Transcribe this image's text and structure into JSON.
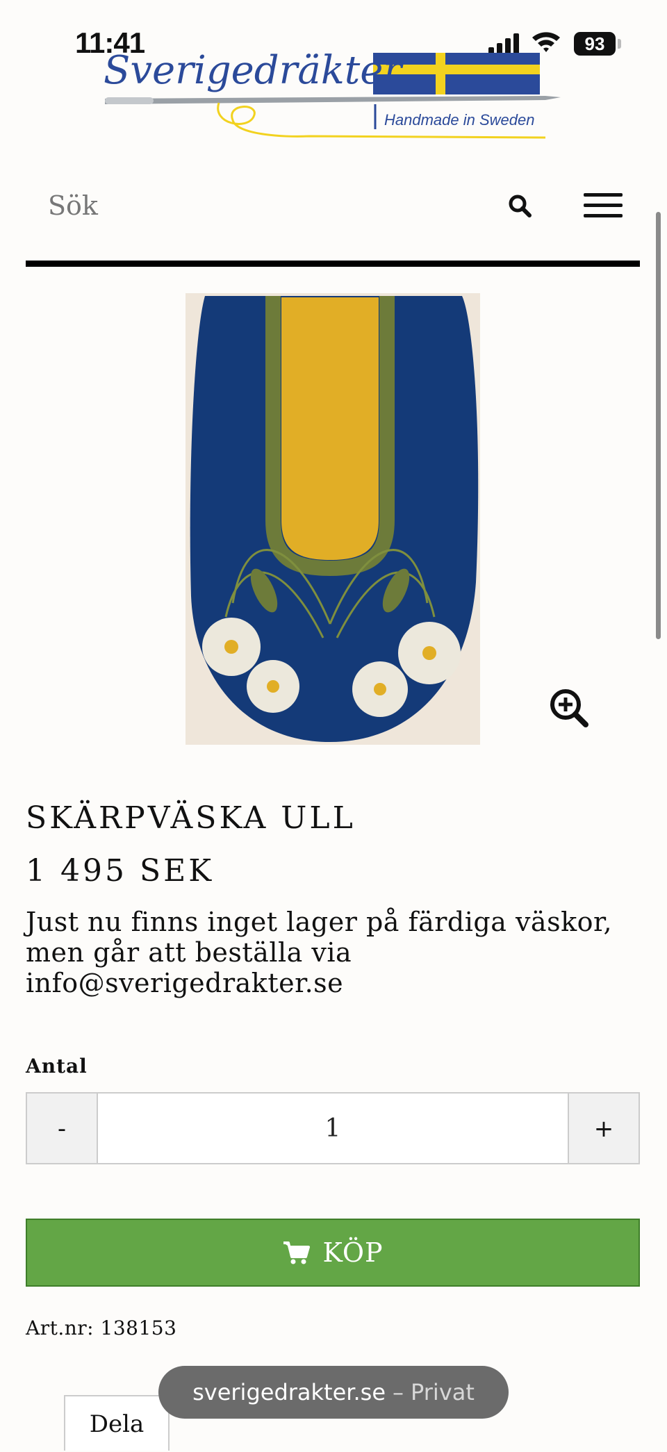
{
  "status_bar": {
    "time": "11:41",
    "battery": "93"
  },
  "logo": {
    "brand": "Sverigedräkter",
    "tagline": "Handmade in Sweden"
  },
  "search": {
    "placeholder": "Sök"
  },
  "product": {
    "title": "SKÄRPVÄSKA ULL",
    "price": "1 495 SEK",
    "stock_note": "Just nu finns inget lager på färdiga väskor, men går att beställa via info@sverigedrakter.se",
    "quantity_label": "Antal",
    "quantity_minus": "-",
    "quantity_value": "1",
    "quantity_plus": "+",
    "buy_label": "KÖP",
    "article_number": "Art.nr: 138153",
    "share_label": "Dela"
  },
  "browser": {
    "domain": "sverigedrakter.se",
    "separator": "–",
    "mode": "Privat"
  },
  "colors": {
    "buy_button": "#63a646",
    "bag_navy": "#143a78",
    "bag_yellow": "#e1ae26",
    "flag_blue": "#2b4a9a",
    "flag_yellow": "#f2d21f"
  }
}
